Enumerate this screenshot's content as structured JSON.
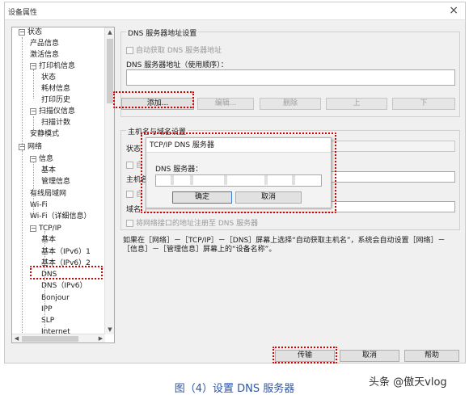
{
  "window": {
    "title": "设备属性",
    "close_glyph": "×"
  },
  "tree": {
    "items": [
      {
        "label": "状态",
        "toggle": "−"
      },
      {
        "label": "产品信息"
      },
      {
        "label": "激活信息"
      },
      {
        "label": "打印机信息",
        "toggle": "−"
      },
      {
        "label": "状态"
      },
      {
        "label": "耗材信息"
      },
      {
        "label": "打印历史"
      },
      {
        "label": "扫描仪信息",
        "toggle": "−"
      },
      {
        "label": "扫描计数"
      },
      {
        "label": "安静模式"
      },
      {
        "label": "网络",
        "toggle": "−"
      },
      {
        "label": "信息",
        "toggle": "−"
      },
      {
        "label": "基本"
      },
      {
        "label": "管理信息"
      },
      {
        "label": "有线局域网"
      },
      {
        "label": "Wi-Fi"
      },
      {
        "label": "Wi-Fi（详细信息）"
      },
      {
        "label": "TCP/IP",
        "toggle": "−"
      },
      {
        "label": "基本"
      },
      {
        "label": "基本（IPv6）1"
      },
      {
        "label": "基本（IPv6）2"
      },
      {
        "label": "DNS"
      },
      {
        "label": "DNS（IPv6）"
      },
      {
        "label": "Bonjour"
      },
      {
        "label": "IPP"
      },
      {
        "label": "SLP"
      },
      {
        "label": "Internet"
      }
    ]
  },
  "dns_group": {
    "title": "DNS 服务器地址设置",
    "auto_obtain": "自动获取 DNS 服务器地址",
    "address_label": "DNS 服务器地址（使用顺序）：",
    "buttons": {
      "add": "添加...",
      "edit": "编辑...",
      "delete": "删除",
      "up": "上",
      "down": "下"
    }
  },
  "host_group": {
    "title": "主机名与域名设置",
    "status_label": "状态",
    "auto_label": "自",
    "hostname_label": "主机名",
    "auto2_label": "自",
    "domain_label": "域名",
    "register_label": "将网络接口的地址注册至 DNS 服务器"
  },
  "note": "如果在［网络］－［TCP/IP］－［DNS］屏幕上选择“自动获取主机名”，系统会自动设置［网络］－［信息］－［管理信息］屏幕上的“设备名称”。",
  "footer": {
    "transmit": "传输",
    "cancel": "取消",
    "help": "帮助"
  },
  "dialog": {
    "title": "TCP/IP DNS 服务器",
    "field_label": "DNS 服务器：",
    "ok": "确定",
    "cancel": "取消"
  },
  "caption": "图（4）设置 DNS 服务器",
  "watermark": "头条 @傲天vlog",
  "colors": {
    "highlight": "#d40000",
    "caption": "#2b56a8"
  }
}
